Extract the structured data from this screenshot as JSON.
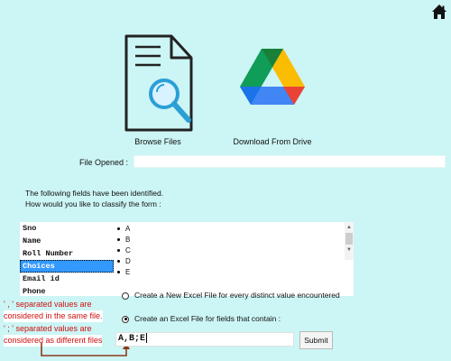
{
  "header": {
    "home_icon": "home-icon"
  },
  "tiles": {
    "browse": {
      "label": "Browse Files",
      "icon": "document-search-icon"
    },
    "drive": {
      "label": "Download From Drive",
      "icon": "google-drive-icon"
    }
  },
  "file_opened": {
    "label": "File Opened :",
    "value": ""
  },
  "intro": {
    "line1": "The following fields have been identified.",
    "line2": "How would you like to classify the form :"
  },
  "fields": {
    "items": [
      "Sno",
      "Name",
      "Roll Number",
      "Choices",
      "Email id",
      "Phone"
    ],
    "selected": "Choices",
    "letters": [
      "A",
      "B",
      "C",
      "D",
      "E"
    ]
  },
  "options": {
    "opt1": "Create a New Excel File for every distinct value encountered",
    "opt2": "Create an Excel File for fields that contain :",
    "selected": "opt2"
  },
  "notes": {
    "comma_line1": "' , ' separated values are",
    "comma_line2": "considered in the same file.",
    "semicolon_line1": "' ; ' separated values are",
    "semicolon_line2": "considered as different files"
  },
  "value_input": {
    "value": "A,B;E"
  },
  "submit": {
    "label": "Submit"
  },
  "colors": {
    "background": "#ccf5f5",
    "selection": "#3399ff",
    "note": "#d01010"
  }
}
